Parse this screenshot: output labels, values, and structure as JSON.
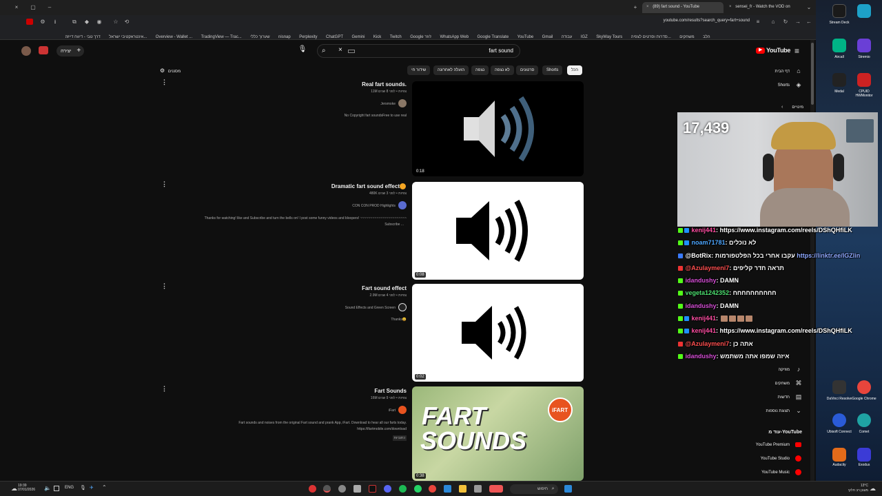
{
  "browser": {
    "tabs": [
      {
        "label": "(89) fart sound - YouTube",
        "active": true
      },
      {
        "label": "sensei_fr - Watch the VOD on",
        "active": false
      }
    ],
    "url": "youtube.com/results?search_query=fart+sound",
    "bookmarks": [
      "דרך טבי - דיווח דייזה",
      "אינטראקטיבי ישראל...",
      "Overview - Wallet ...",
      "TradingView — Trac...",
      "שערוך כללי",
      "nisnap",
      "Perplexity",
      "ChatGPT",
      "Gemini",
      "Kick",
      "Twitch",
      "Google ז'וזר",
      "WhatsApp Web",
      "Google Translate",
      "YouTube",
      "Gmail",
      "עבודה",
      "IGZ",
      "SkyWay Tours",
      "סדרות וסרטים לצפיה...",
      "משחקים",
      "הלב"
    ]
  },
  "youtube": {
    "logo_text": "YouTube",
    "search_query": "fart sound",
    "create_label": "יצירה",
    "filters_label": "מסננים",
    "chips": [
      {
        "label": "הכל",
        "active": true
      },
      {
        "label": "Shorts",
        "active": false
      },
      {
        "label": "סרטונים",
        "active": false
      },
      {
        "label": "לא נצפה",
        "active": false
      },
      {
        "label": "נצפה",
        "active": false
      },
      {
        "label": "הועלה לאחרונה",
        "active": false
      },
      {
        "label": "שידור חי",
        "active": false
      }
    ],
    "sidebar": {
      "home": "דף הבית",
      "shorts": "Shorts",
      "subscriptions": "מינויים",
      "lower_items": [
        "מוזיקה",
        "משחקים",
        "חדשות",
        "תצוגת נוספות"
      ],
      "more_from_header": "עוד מ-YouTube",
      "more_from": [
        "YouTube Premium",
        "YouTube Studio",
        "YouTube Music"
      ]
    },
    "results": [
      {
        "title": "Real fart sounds.",
        "meta": "11M צפיות • לפני 8 שנים",
        "channel": "Jersmoke",
        "description": "No Copyright fart soundsFree to use real",
        "description2": "",
        "duration": "0:18"
      },
      {
        "title": "Dramatic fart sound effect",
        "meta": "480K צפיות • לפני 3 שנים",
        "channel": "CON CON PROD Highlights",
        "description": "Thanks for watching! like and Subscribe and turn the bells on! I post some funny videos and bloopers! ~~~~~~~~~~~~~~~~~~~~~~~",
        "description2": "Subscribe ...",
        "duration": "0:08"
      },
      {
        "title": "Fart sound effect",
        "meta": "2.9M צפיות • לפני 4 שנים",
        "channel": "Sound Effects and Green Screen",
        "description": "Thanks😄",
        "description2": "",
        "duration": "0:02"
      },
      {
        "title": "Fart Sounds",
        "meta": "16M צפיות • לפני 9 שנים",
        "channel": "iFart",
        "description": "Fart sounds and noises from the original Fart sound and prank App, iFart. Download to hear all our farts today.",
        "description2": "https://ifartmobile.com/download",
        "description3": "כתוביות",
        "duration": "0:38",
        "thumb_text_1": "FART",
        "thumb_text_2": "SOUNDS",
        "thumb_badge": "iFART"
      }
    ]
  },
  "stream": {
    "viewer_count": "17,439",
    "chat": [
      {
        "user": "kenij441",
        "color": "#ff4fa3",
        "message": ": https://www.instagram.com/reels/DShQHfiLK"
      },
      {
        "user": "noam71781",
        "color": "#4da6ff",
        "message": ": לא נוכלים"
      },
      {
        "user": "@BotRix",
        "color": "#ffffff",
        "message": ": עקבו אחרי בכל הפלטפורמות",
        "link": "https://linktr.ee/IGZlin"
      },
      {
        "user": "@Azulaymeni7",
        "color": "#ff5050",
        "message": ": תראה חדר קליפים"
      },
      {
        "user": "idandushy",
        "color": "#d64fd6",
        "message": ": DAMN"
      },
      {
        "user": "vegeta1242352",
        "color": "#4de070",
        "message": ": חחחחחחחחחח"
      },
      {
        "user": "idandushy",
        "color": "#d64fd6",
        "message": ": DAMN"
      },
      {
        "user": "kenij441",
        "color": "#ff4fa3",
        "message": ":"
      },
      {
        "user": "kenij441",
        "color": "#ff4fa3",
        "message": ": https://www.instagram.com/reels/DShQHfiLK"
      },
      {
        "user": "@Azulaymeni7",
        "color": "#ff5050",
        "message": ": אתה כן"
      },
      {
        "user": "idandushy",
        "color": "#d64fd6",
        "message": ": איזה שמפו אתה משתמש"
      }
    ]
  },
  "desktop": {
    "icons": [
      {
        "label": "Stream Deck",
        "color": "#1a1a1a"
      },
      {
        "label": "Aircall",
        "color": "#00b386"
      },
      {
        "label": "Stremio",
        "color": "#6a3fd6"
      },
      {
        "label": "Medal",
        "color": "#222"
      },
      {
        "label": "CPUID HWMonitor",
        "color": "#c22"
      },
      {
        "label": "DaVinci Resolve",
        "color": "#333"
      },
      {
        "label": "Google Chrome",
        "color": "#e8453c"
      },
      {
        "label": "Ubisoft Connect",
        "color": "#2a5bd7"
      },
      {
        "label": "Comet",
        "color": "#1fa3a3"
      },
      {
        "label": "Audacity",
        "color": "#e36b1a"
      },
      {
        "label": "Exodus",
        "color": "#3b3bd6"
      }
    ]
  },
  "taskbar": {
    "time": "19:39",
    "date": "07/01/2026",
    "lang": "ENG",
    "search_placeholder": "חיפוש",
    "weather": "13°C",
    "weather_desc": "מעונן רב חלקי"
  }
}
